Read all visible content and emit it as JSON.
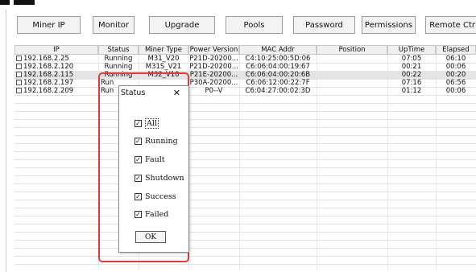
{
  "toolbar": {
    "buttons": [
      "Miner IP",
      "Monitor",
      "Upgrade",
      "Pools",
      "Password",
      "Permissions",
      "Remote Ctrl"
    ]
  },
  "table": {
    "columns": [
      "IP",
      "Status",
      "Miner Type",
      "Power Version",
      "MAC Addr",
      "Position",
      "UpTime",
      "Elapsed"
    ],
    "rows": [
      [
        "192.168.2.25",
        "Running",
        "M31_V20",
        "P21D-20200...",
        "C4:10:25:00:5D:06",
        "",
        "07:05",
        "06:10"
      ],
      [
        "192.168.2.120",
        "Running",
        "M31S_V21",
        "P21D-20200...",
        "C6:06:04:00:19:67",
        "",
        "00:21",
        "00:06"
      ],
      [
        "192.168.2.115",
        "Running",
        "M32_V10",
        "P21E-20200...",
        "C6:06:04:00:20:6B",
        "",
        "00:22",
        "00:20"
      ],
      [
        "192.168.2.197",
        "Run",
        "",
        "P30A-20200...",
        "C6:06:12:00:22:7F",
        "",
        "07:16",
        "06:56"
      ],
      [
        "192.168.2.209",
        "Run",
        "",
        "P0--V",
        "C6:04:27:00:02:3D",
        "",
        "01:12",
        "00:06"
      ]
    ]
  },
  "dialog": {
    "title": "Status",
    "close": "✕",
    "options": [
      {
        "label": "All",
        "checked": true
      },
      {
        "label": "Running",
        "checked": true
      },
      {
        "label": "Fault",
        "checked": true
      },
      {
        "label": "Shutdown",
        "checked": true
      },
      {
        "label": "Success",
        "checked": true
      },
      {
        "label": "Failed",
        "checked": true
      }
    ],
    "ok_label": "OK",
    "check_mark": "✓"
  },
  "colors": {
    "highlight_border": "#e53935",
    "selected_row": "#e4e4e4"
  }
}
